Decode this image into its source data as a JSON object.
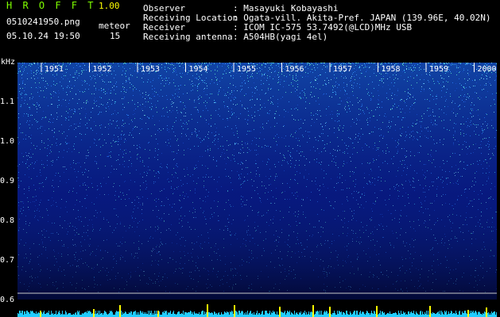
{
  "header": {
    "app_title": "H R O F F T",
    "app_version": "1.00",
    "filename": "0510241950.png",
    "datetime": "05.10.24 19:50",
    "meteor_label": "meteor",
    "meteor_count": "15"
  },
  "info": [
    {
      "label": "Observer",
      "value": ": Masayuki Kobayashi"
    },
    {
      "label": "Receiving Location",
      "value": ": Ogata-vill. Akita-Pref. JAPAN (139.96E, 40.02N)"
    },
    {
      "label": "Receiver",
      "value": ": ICOM IC-575 53.7492(@LCD)MHz USB"
    },
    {
      "label": "Receiving antenna",
      "value": ": A504HB(yagi 4el)"
    }
  ],
  "axis": {
    "ylabel": "kHz",
    "yticks": [
      "1.1",
      "1.0",
      "0.9",
      "0.8",
      "0.7",
      "0.6"
    ],
    "time_labels": [
      "1951",
      "1952",
      "1953",
      "1954",
      "1955",
      "1956",
      "1957",
      "1958",
      "1959",
      "2000"
    ]
  },
  "colors": {
    "header_green": "#7fff00",
    "header_white": "#ffffff",
    "spectrogram_base": "#061070",
    "signal_cyan": "#22ccff",
    "meteor_yellow": "#ffff00"
  }
}
